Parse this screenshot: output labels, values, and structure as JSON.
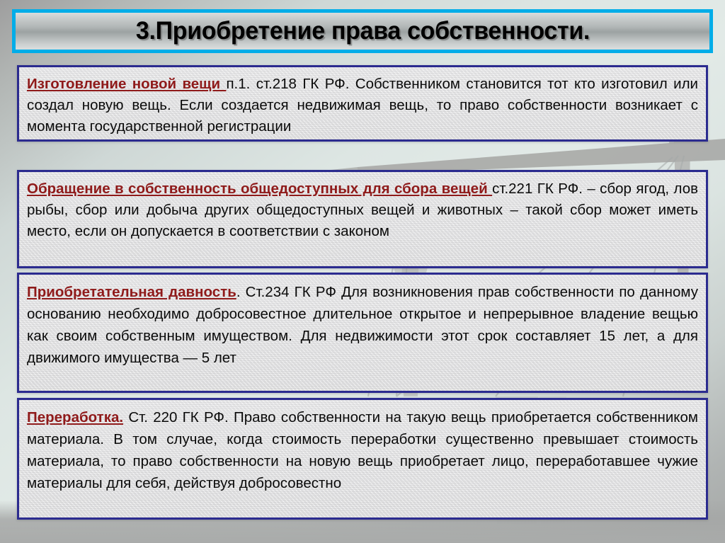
{
  "slide": {
    "title": "3.Приобретение права собственности.",
    "title_border_color": "#00ade8",
    "box_border_color": "#2b2b8f",
    "heading_color": "#8f1a1a",
    "body_text_color": "#0a0a0a",
    "background_decor": "grey-bridge-silhouette"
  },
  "boxes": [
    {
      "id": "box-1",
      "heading": "Изготовление новой вещи ",
      "body": "п.1. ст.218 ГК РФ. Собственником становится тот кто изготовил или создал новую вещь. Если создается недвижимая вещь, то право собственности возникает с момента государственной регистрации"
    },
    {
      "id": "box-2",
      "heading": "Обращение в собственность общедоступных для сбора вещей ",
      "body": "ст.221 ГК РФ. – сбор ягод, лов рыбы, сбор или добыча других общедоступных вещей и животных – такой сбор может иметь место, если он допускается в соответствии с законом"
    },
    {
      "id": "box-3",
      "heading": "Приобретательная  давность",
      "body": ". Ст.234 ГК РФ Для возникновения прав собственности по данному основанию необходимо добросовестное длительное открытое и непрерывное владение вещью как своим собственным имуществом. Для недвижимости этот срок составляет 15 лет, а для движимого имущества — 5 лет"
    },
    {
      "id": "box-4",
      "heading": "Переработка.",
      "body": " Ст. 220 ГК РФ. Право собственности на такую вещь приобретается собственником материала. В том случае, когда стоимость переработки существенно превышает стоимость материала, то право собственности на новую вещь приобретает лицо, переработавшее чужие материалы для себя, действуя добросовестно"
    }
  ]
}
